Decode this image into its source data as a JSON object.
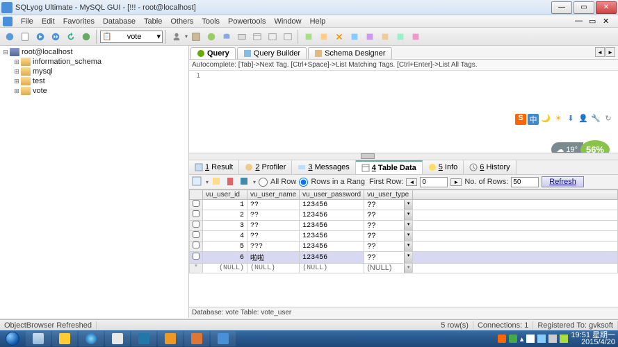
{
  "window": {
    "title": "SQLyog Ultimate - MySQL GUI - [!!! - root@localhost]",
    "min": "—",
    "max": "▭",
    "close": "✕",
    "inner_min": "—",
    "inner_max": "▭",
    "inner_close": "✕"
  },
  "menu": [
    "File",
    "Edit",
    "Favorites",
    "Database",
    "Table",
    "Others",
    "Tools",
    "Powertools",
    "Window",
    "Help"
  ],
  "db_selector": "vote",
  "tree": {
    "root": "root@localhost",
    "items": [
      "information_schema",
      "mysql",
      "test",
      "vote"
    ]
  },
  "upper_tabs": {
    "query": "Query",
    "builder": "Query Builder",
    "schema": "Schema Designer"
  },
  "hint": "Autocomplete: [Tab]->Next Tag. [Ctrl+Space]->List Matching Tags. [Ctrl+Enter]->List All Tags.",
  "editor_line": "1",
  "overlay_icons": [
    "S",
    "中",
    "🌙",
    "☀",
    "⬇",
    "👤",
    "🔧",
    "↻"
  ],
  "weather": {
    "temp": "19°",
    "percent": "56%"
  },
  "bottom_tabs": {
    "result": "1 Result",
    "profiler": "2 Profiler",
    "messages": "3 Messages",
    "tabledata": "4 Table Data",
    "info": "5 Info",
    "history": "6 History"
  },
  "gridbar": {
    "allrow": "All Row",
    "range": "Rows in a Rang",
    "first_label": "First Row:",
    "first_val": "0",
    "num_label": "No. of Rows:",
    "num_val": "50",
    "refresh": "Refresh"
  },
  "columns": [
    "vu_user_id",
    "vu_user_name",
    "vu_user_password",
    "vu_user_type"
  ],
  "rows": [
    {
      "id": "1",
      "name": "??",
      "pw": "123456",
      "type": "??"
    },
    {
      "id": "2",
      "name": "??",
      "pw": "123456",
      "type": "??"
    },
    {
      "id": "3",
      "name": "??",
      "pw": "123456",
      "type": "??"
    },
    {
      "id": "4",
      "name": "??",
      "pw": "123456",
      "type": "??"
    },
    {
      "id": "5",
      "name": "???",
      "pw": "123456",
      "type": "??"
    },
    {
      "id": "6",
      "name": "啦啦",
      "pw": "123456",
      "type": "??"
    }
  ],
  "nullrow": {
    "id": "(NULL)",
    "name": "(NULL)",
    "pw": "(NULL)",
    "type": "(NULL)"
  },
  "inner_status": "Database: vote Table: vote_user",
  "app_status": {
    "left": "ObjectBrowser Refreshed",
    "rows": "5 row(s)",
    "conn": "Connections: 1",
    "reg": "Registered To: gvksoft"
  },
  "tray": {
    "time": "19:51",
    "day": "星期一",
    "date": "2015/4/20"
  },
  "chart_data": {
    "type": "table",
    "title": "vote_user",
    "columns": [
      "vu_user_id",
      "vu_user_name",
      "vu_user_password",
      "vu_user_type"
    ],
    "rows": [
      [
        1,
        "??",
        "123456",
        "??"
      ],
      [
        2,
        "??",
        "123456",
        "??"
      ],
      [
        3,
        "??",
        "123456",
        "??"
      ],
      [
        4,
        "??",
        "123456",
        "??"
      ],
      [
        5,
        "???",
        "123456",
        "??"
      ],
      [
        6,
        "啦啦",
        "123456",
        "??"
      ]
    ]
  }
}
